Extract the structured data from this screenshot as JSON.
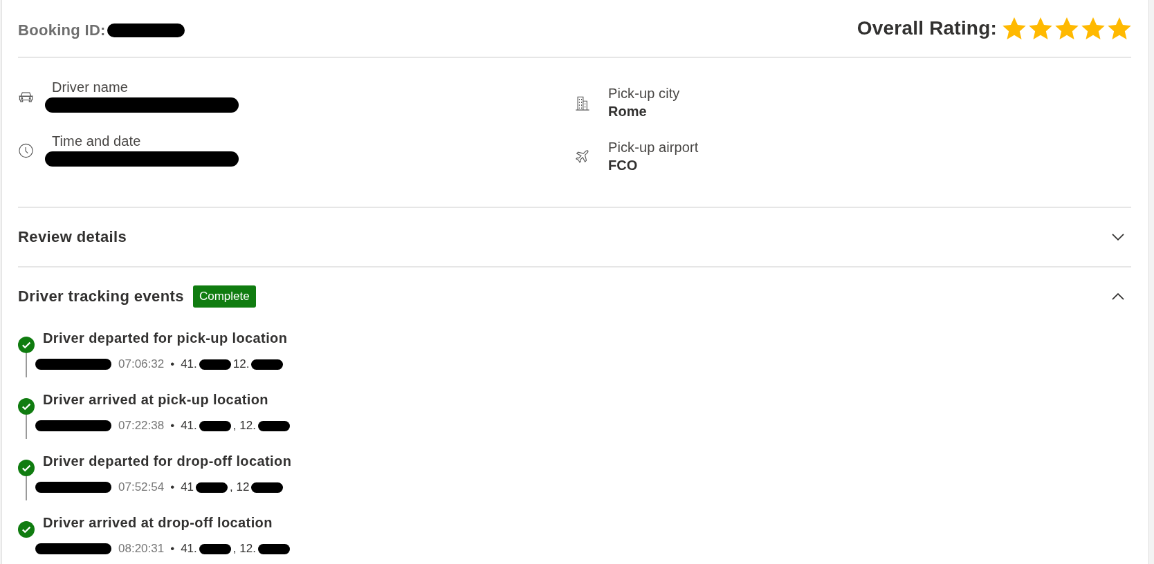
{
  "booking": {
    "label": "Booking ID:",
    "redacted": true
  },
  "rating": {
    "label": "Overall Rating:",
    "stars": 5
  },
  "detail_columns": [
    [
      {
        "label": "Driver name",
        "redacted": true
      },
      {
        "label": "Time and date",
        "redacted": true
      }
    ],
    [
      {
        "label": "Pick-up city",
        "value": "Rome",
        "redacted": false
      },
      {
        "label": "Pick-up airport",
        "value": "FCO",
        "redacted": false
      }
    ]
  ],
  "sections": [
    {
      "title": "Review details",
      "expanded": false
    },
    {
      "title": "Driver tracking events",
      "expanded": true,
      "badge": "Complete",
      "events": [
        {
          "title": "Driver departed for pick-up location",
          "completed": true,
          "meta": [
            {
              "kind": "redacted"
            },
            {
              "kind": "time",
              "text": "07:06:32"
            },
            {
              "kind": "separator",
              "text": "•"
            },
            {
              "kind": "coordinate",
              "text": "41."
            },
            {
              "kind": "redacted"
            },
            {
              "kind": "coordinate",
              "text": "12."
            },
            {
              "kind": "redacted"
            }
          ]
        },
        {
          "title": "Driver arrived at pick-up location",
          "completed": true,
          "meta": [
            {
              "kind": "redacted"
            },
            {
              "kind": "time",
              "text": "07:22:38"
            },
            {
              "kind": "separator",
              "text": "•"
            },
            {
              "kind": "coordinate",
              "text": "41."
            },
            {
              "kind": "redacted"
            },
            {
              "kind": "coordinate",
              "text": ", 12."
            },
            {
              "kind": "redacted"
            }
          ]
        },
        {
          "title": "Driver departed for drop-off location",
          "completed": true,
          "meta": [
            {
              "kind": "redacted"
            },
            {
              "kind": "time",
              "text": "07:52:54"
            },
            {
              "kind": "separator",
              "text": "•"
            },
            {
              "kind": "coordinate",
              "text": "41"
            },
            {
              "kind": "redacted"
            },
            {
              "kind": "coordinate",
              "text": ", 12"
            },
            {
              "kind": "redacted"
            }
          ]
        },
        {
          "title": "Driver arrived at drop-off location",
          "completed": true,
          "meta": [
            {
              "kind": "redacted"
            },
            {
              "kind": "time",
              "text": "08:20:31"
            },
            {
              "kind": "separator",
              "text": "•"
            },
            {
              "kind": "coordinate",
              "text": "41."
            },
            {
              "kind": "redacted"
            },
            {
              "kind": "coordinate",
              "text": ", 12."
            },
            {
              "kind": "redacted"
            }
          ]
        }
      ]
    }
  ]
}
